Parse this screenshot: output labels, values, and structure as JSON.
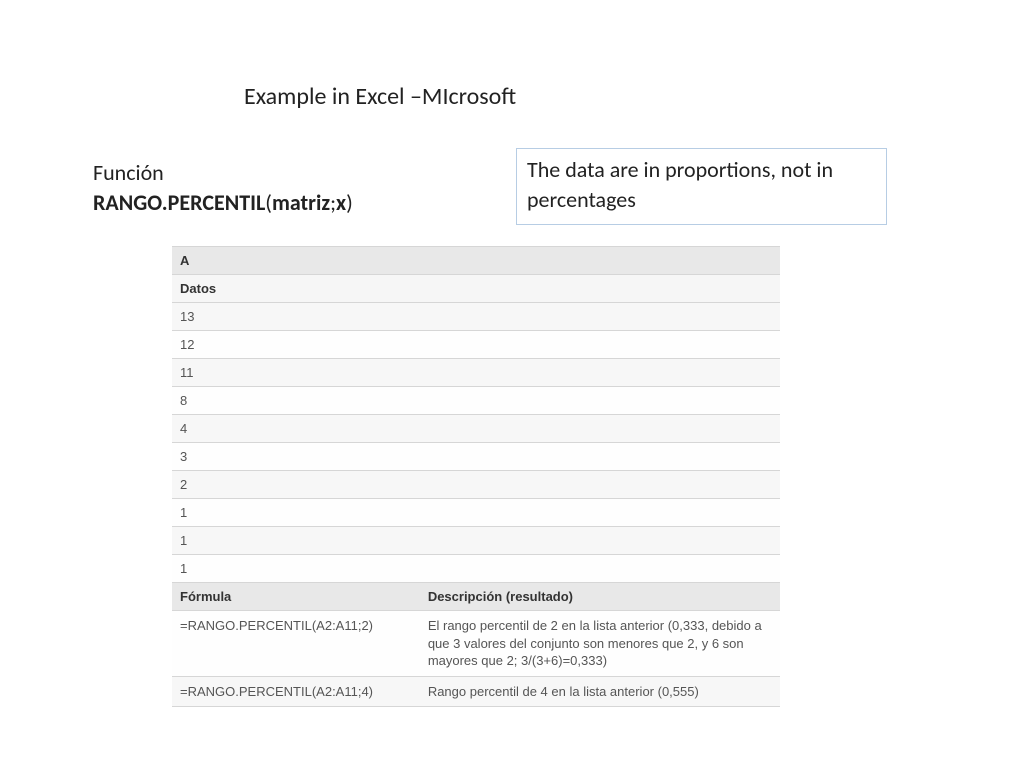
{
  "title": "Example in Excel –MIcrosoft",
  "function": {
    "label": "Función",
    "name": "RANGO.PERCENTIL",
    "arg1": "matriz",
    "sep": ";",
    "arg2": "x"
  },
  "note": "The data are in proportions, not in percentages",
  "table": {
    "col_header": "A",
    "data_label": "Datos",
    "values": [
      "13",
      "12",
      "11",
      "8",
      "4",
      "3",
      "2",
      "1",
      "1",
      "1"
    ],
    "formula_header": "Fórmula",
    "desc_header": "Descripción (resultado)",
    "rows": [
      {
        "formula": "=RANGO.PERCENTIL(A2:A11;2)",
        "desc": "El rango percentil de 2 en la lista anterior (0,333, debido a que 3 valores del conjunto son menores que 2, y 6 son mayores que 2; 3/(3+6)=0,333)"
      },
      {
        "formula": "=RANGO.PERCENTIL(A2:A11;4)",
        "desc": "Rango percentil de 4 en la lista anterior (0,555)"
      }
    ]
  }
}
